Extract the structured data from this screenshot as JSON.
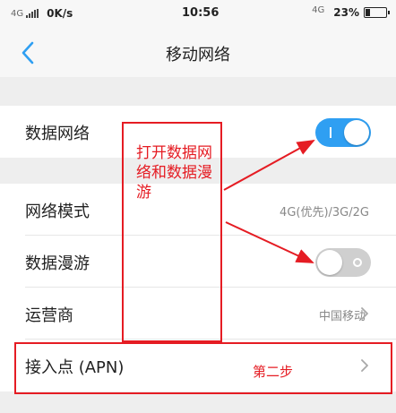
{
  "status_bar": {
    "network_left": "4G",
    "speed": "0K/s",
    "time": "10:56",
    "network_right": "4G",
    "battery_percent_text": "23%",
    "battery_level": 0.23
  },
  "header": {
    "title": "移动网络",
    "back_icon": "chevron-left-icon"
  },
  "settings": {
    "data_network": {
      "label": "数据网络",
      "toggle_on": true
    },
    "network_mode": {
      "label": "网络模式",
      "value": "4G(优先)/3G/2G"
    },
    "data_roaming": {
      "label": "数据漫游",
      "toggle_on": false
    },
    "carrier": {
      "label": "运营商",
      "value": "中国移动"
    },
    "apn": {
      "label": "接入点 (APN)"
    }
  },
  "annotations": {
    "note_1": "打开数据网络和数据漫游",
    "note_2": "第二步",
    "color": "#e51c23"
  },
  "colors": {
    "accent": "#2f9ff2",
    "toggle_off": "#cfcfcf",
    "background": "#eeeeee"
  }
}
